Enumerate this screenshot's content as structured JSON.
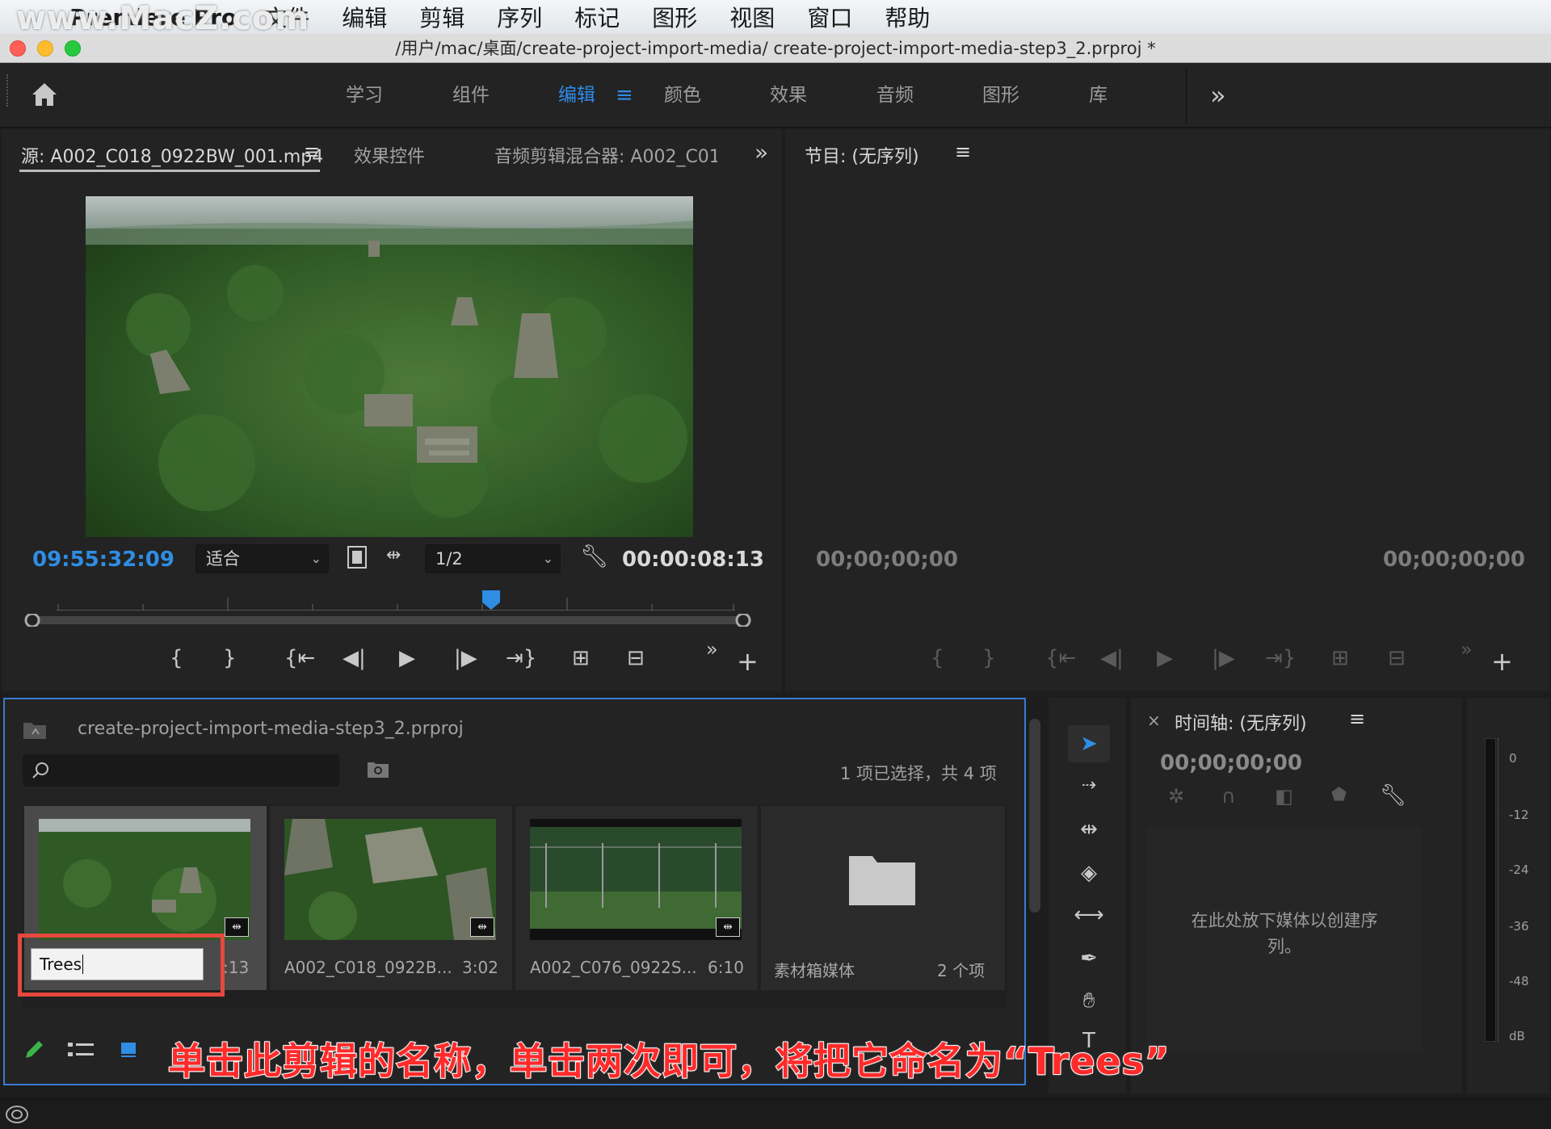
{
  "menubar": {
    "app_name": "Premiere Pro",
    "items": [
      "文件",
      "编辑",
      "剪辑",
      "序列",
      "标记",
      "图形",
      "视图",
      "窗口",
      "帮助"
    ]
  },
  "watermark": "www.MacZ.com",
  "window": {
    "title": "/用户/mac/桌面/create-project-import-media/  create-project-import-media-step3_2.prproj *"
  },
  "workspaces": {
    "tabs": [
      "学习",
      "组件",
      "编辑",
      "颜色",
      "效果",
      "音频",
      "图形",
      "库"
    ],
    "active": "编辑",
    "menu_icon": "≡",
    "more": "»"
  },
  "source_panel": {
    "tabs": [
      "源: A002_C018_0922BW_001.mp4",
      "效果控件",
      "音频剪辑混合器: A002_C01"
    ],
    "menu_icon": "≡",
    "more": "»",
    "current_timecode": "09:55:32:09",
    "fit_label": "适合",
    "resolution_label": "1/2",
    "duration": "00:00:08:13"
  },
  "program_panel": {
    "title": "节目: (无序列)",
    "menu_icon": "≡",
    "timecode_left": "00;00;00;00",
    "timecode_right": "00;00;00;00"
  },
  "project_panel": {
    "project_name": "create-project-import-media-step3_2.prproj",
    "search_placeholder": "",
    "selection_status": "1 项已选择，共 4 项",
    "items": [
      {
        "name": "Trees",
        "duration": ":13",
        "editing": true
      },
      {
        "name": "A002_C018_0922B...",
        "duration": "3:02"
      },
      {
        "name": "A002_C076_0922S...",
        "duration": "6:10"
      },
      {
        "name": "素材箱媒体",
        "duration": "2 个项"
      }
    ]
  },
  "timeline_panel": {
    "title": "时间轴: (无序列)",
    "close_icon": "×",
    "menu_icon": "≡",
    "timecode": "00;00;00;00",
    "drop_hint": "在此处放下媒体以创建序列。"
  },
  "audio_meter": {
    "labels": [
      "0",
      "-12",
      "-24",
      "-36",
      "-48",
      "dB"
    ]
  },
  "colors": {
    "accent": "#2f8de4",
    "panel_bg": "#232323",
    "highlight_box": "#e5483d"
  },
  "caption": "单击此剪辑的名称，单击两次即可，将把它命名为“Trees”"
}
